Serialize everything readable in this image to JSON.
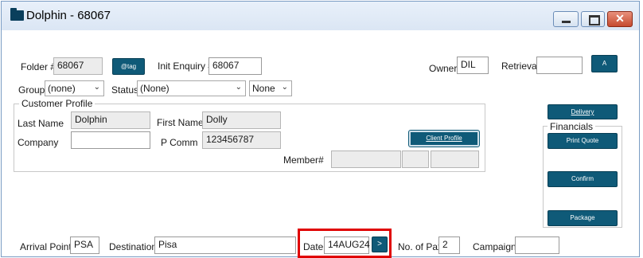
{
  "window": {
    "title": "Dolphin - 68067"
  },
  "header": {
    "folder_label": "Folder #",
    "folder_value": "68067",
    "tag_button": "@tag",
    "init_enquiry_label": "Init Enquiry #",
    "init_enquiry_value": "68067",
    "owner_label": "Owner",
    "owner_value": "DIL",
    "retrieval_label": "Retrieval",
    "retrieval_value": "",
    "a_button": "A"
  },
  "filters": {
    "group_label": "Group",
    "group_value": "(none)",
    "status_label": "Status",
    "status_value": "(None)",
    "none_value": "None"
  },
  "customer_profile": {
    "title": "Customer Profile",
    "last_name_label": "Last Name",
    "last_name_value": "Dolphin",
    "first_name_label": "First Name",
    "first_name_value": "Dolly",
    "company_label": "Company",
    "company_value": "",
    "pcomm_label": "P Comm",
    "pcomm_value": "123456787",
    "client_profile_button": "Client Profile",
    "member_label": "Member#"
  },
  "side": {
    "delivery_button": "Delivery",
    "financials_title": "Financials",
    "print_quote_button": "Print Quote",
    "confirm_button": "Confirm",
    "package_button": "Package"
  },
  "footer": {
    "arrival_label": "Arrival Point",
    "arrival_value": "PSA",
    "destination_label": "Destination",
    "destination_value": "Pisa",
    "date_label": "Date",
    "date_value": "14AUG24",
    "date_button": ">",
    "pax_label": "No. of Pax",
    "pax_value": "2",
    "campaign_label": "Campaign",
    "campaign_value": ""
  },
  "colors": {
    "teal": "#0f5a78",
    "highlight": "#e00000"
  }
}
